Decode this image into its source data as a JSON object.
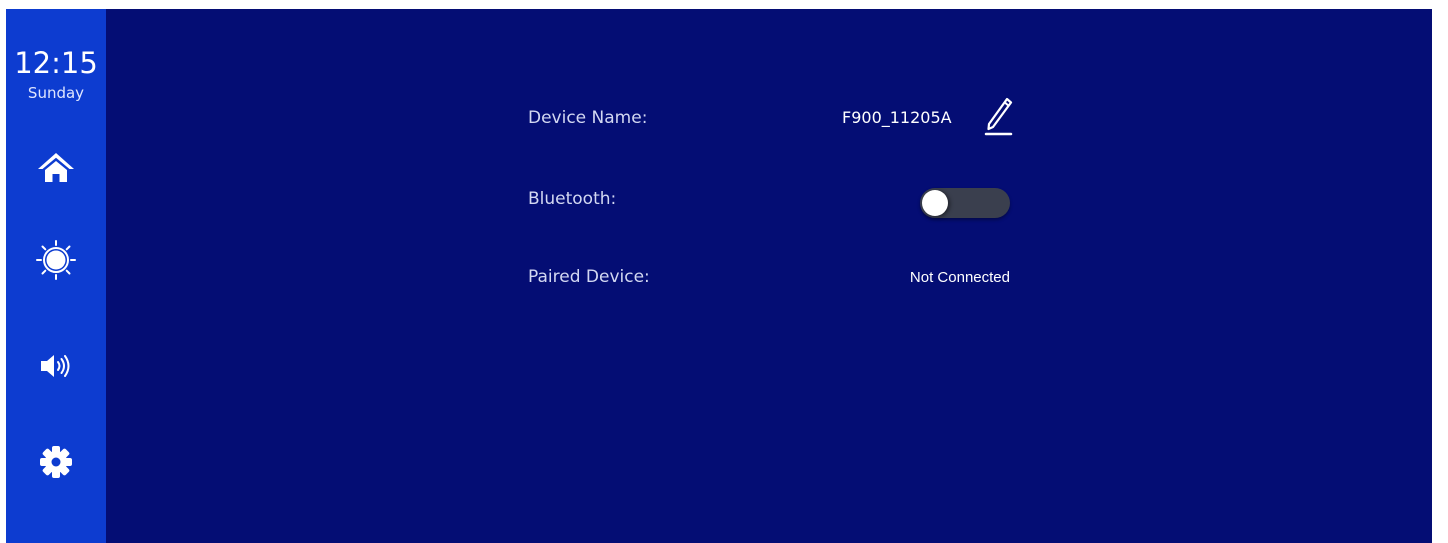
{
  "sidebar": {
    "time": "12:15",
    "day": "Sunday",
    "nav": [
      {
        "name": "home",
        "icon": "home-icon"
      },
      {
        "name": "brightness",
        "icon": "brightness-icon"
      },
      {
        "name": "volume",
        "icon": "volume-icon"
      },
      {
        "name": "settings",
        "icon": "gear-icon"
      }
    ]
  },
  "bluetooth_settings": {
    "device_name_label": "Device Name:",
    "device_name_value": "F900_11205A",
    "edit_icon": "pencil-icon",
    "bluetooth_label": "Bluetooth:",
    "bluetooth_enabled": false,
    "paired_device_label": "Paired Device:",
    "paired_device_value": "Not Connected"
  },
  "colors": {
    "background": "#040d74",
    "sidebar": "#0d3cd0",
    "toggle_off": "#3a3f4e"
  }
}
